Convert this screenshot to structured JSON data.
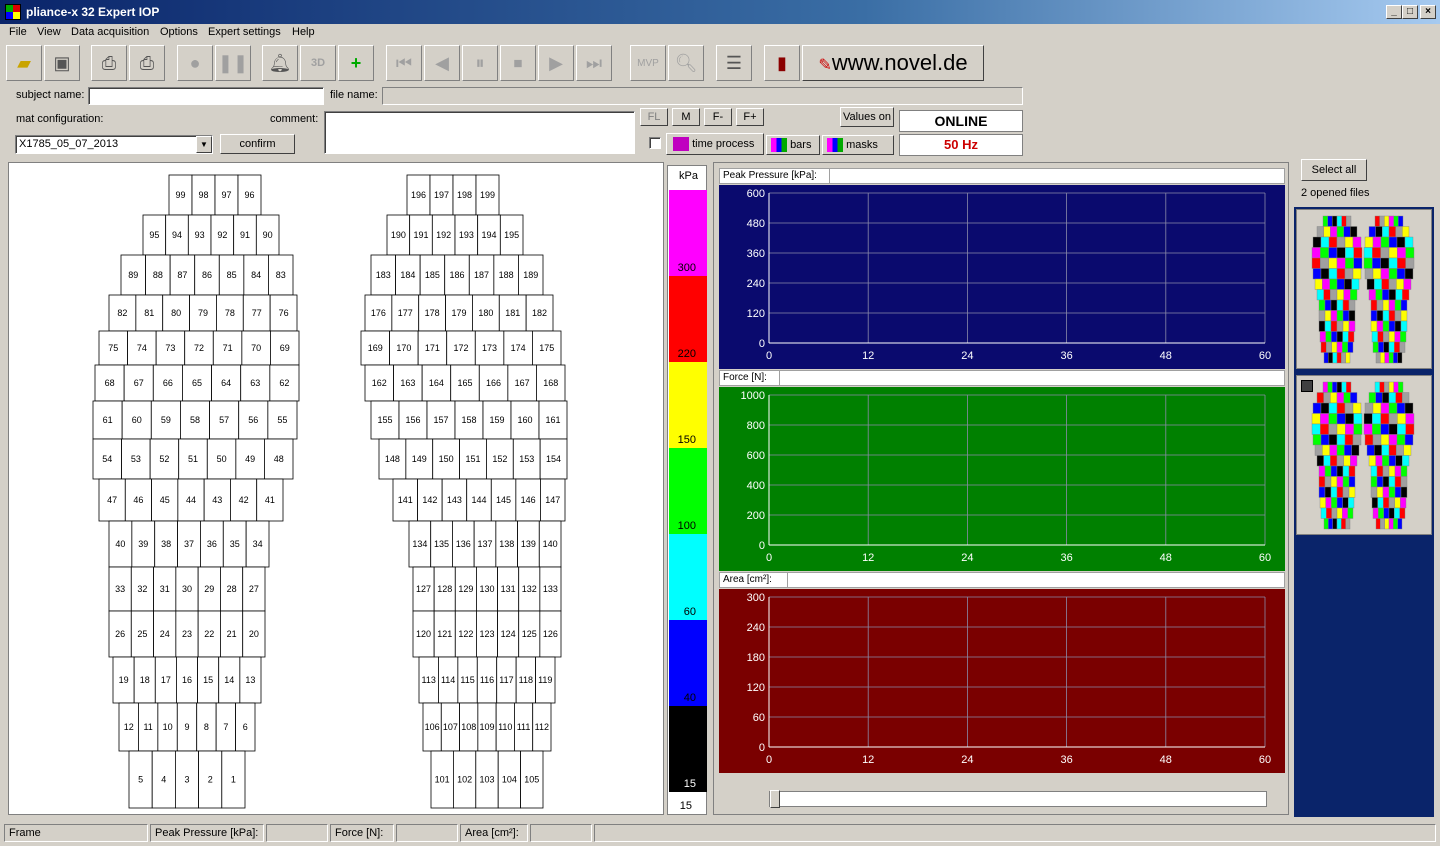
{
  "window": {
    "title": "pliance-x 32 Expert IOP",
    "btn_min": "_",
    "btn_max": "□",
    "btn_close": "×"
  },
  "menu": [
    "File",
    "View",
    "Data acquisition",
    "Options",
    "Expert settings",
    "Help"
  ],
  "toolbar": {
    "icons": [
      "open-folder",
      "save",
      "print",
      "print-preview",
      "record",
      "pause",
      "alarm-bell",
      "3d-view",
      "add-steps",
      "first-frame",
      "prev-frame",
      "pause-playback",
      "stop-playback",
      "next-frame",
      "last-frame",
      "mvp",
      "zoom",
      "notes",
      "exit-door"
    ],
    "mvp_label": "MVP",
    "threed_label": "3D",
    "brand_link": "www.novel.de"
  },
  "form": {
    "subject_label": "subject name:",
    "subject_value": "",
    "file_label": "file name:",
    "file_value": "",
    "mat_label": "mat configuration:",
    "mat_value": "X1785_05_07_2013",
    "confirm": "confirm",
    "comment_label": "comment:",
    "comment_value": "",
    "fl": "FL",
    "m": "M",
    "fminus": "F-",
    "fplus": "F+",
    "values_on": "Values on",
    "time_process": "time process",
    "bars": "bars",
    "masks": "masks",
    "status": "ONLINE",
    "frequency": "50 Hz"
  },
  "sensors": {
    "left": [
      [
        99,
        98,
        97,
        96
      ],
      [
        95,
        94,
        93,
        92,
        91,
        90
      ],
      [
        89,
        88,
        87,
        86,
        85,
        84,
        83
      ],
      [
        82,
        81,
        80,
        79,
        78,
        77,
        76
      ],
      [
        75,
        74,
        73,
        72,
        71,
        70,
        69
      ],
      [
        68,
        67,
        66,
        65,
        64,
        63,
        62
      ],
      [
        61,
        60,
        59,
        58,
        57,
        56,
        55
      ],
      [
        54,
        53,
        52,
        51,
        50,
        49,
        48
      ],
      [
        47,
        46,
        45,
        44,
        43,
        42,
        41
      ],
      [
        40,
        39,
        38,
        37,
        36,
        35,
        34
      ],
      [
        33,
        32,
        31,
        30,
        29,
        28,
        27
      ],
      [
        26,
        25,
        24,
        23,
        22,
        21,
        20
      ],
      [
        19,
        18,
        17,
        16,
        15,
        14,
        13
      ],
      [
        12,
        11,
        10,
        9,
        8,
        7,
        6
      ],
      [
        5,
        4,
        3,
        2,
        1
      ]
    ],
    "right": [
      [
        196,
        197,
        198,
        199
      ],
      [
        190,
        191,
        192,
        193,
        194,
        195
      ],
      [
        183,
        184,
        185,
        186,
        187,
        188,
        189
      ],
      [
        176,
        177,
        178,
        179,
        180,
        181,
        182
      ],
      [
        169,
        170,
        171,
        172,
        173,
        174,
        175
      ],
      [
        162,
        163,
        164,
        165,
        166,
        167,
        168
      ],
      [
        155,
        156,
        157,
        158,
        159,
        160,
        161
      ],
      [
        148,
        149,
        150,
        151,
        152,
        153,
        154
      ],
      [
        141,
        142,
        143,
        144,
        145,
        146,
        147
      ],
      [
        134,
        135,
        136,
        137,
        138,
        139,
        140
      ],
      [
        127,
        128,
        129,
        130,
        131,
        132,
        133
      ],
      [
        120,
        121,
        122,
        123,
        124,
        125,
        126
      ],
      [
        113,
        114,
        115,
        116,
        117,
        118,
        119
      ],
      [
        106,
        107,
        108,
        109,
        110,
        111,
        112
      ],
      [
        101,
        102,
        103,
        104,
        105
      ]
    ]
  },
  "scale": {
    "unit": "kPa",
    "labels": [
      "300",
      "220",
      "150",
      "100",
      "60",
      "40",
      "15"
    ],
    "bottom": "15",
    "colors": [
      "#ff00ff",
      "#ff0000",
      "#ffff00",
      "#00ff00",
      "#00ffff",
      "#0000ff",
      "#000000"
    ]
  },
  "chart_data": [
    {
      "type": "line",
      "title": "Peak Pressure  [kPa]:",
      "x": [
        0,
        12,
        24,
        36,
        48,
        60
      ],
      "yticks": [
        0,
        120,
        240,
        360,
        480,
        600
      ],
      "ylim": [
        0,
        600
      ],
      "xlim": [
        0,
        60
      ],
      "background": "#0a0a6e",
      "series": []
    },
    {
      "type": "line",
      "title": "Force [N]:",
      "x": [
        0,
        12,
        24,
        36,
        48,
        60
      ],
      "yticks": [
        0,
        200,
        400,
        600,
        800,
        1000
      ],
      "ylim": [
        0,
        1000
      ],
      "xlim": [
        0,
        60
      ],
      "background": "#008000",
      "series": []
    },
    {
      "type": "line",
      "title": "Area [cm²]:",
      "x": [
        0,
        12,
        24,
        36,
        48,
        60
      ],
      "yticks": [
        0,
        60,
        120,
        180,
        240,
        300
      ],
      "ylim": [
        0,
        300
      ],
      "xlim": [
        0,
        60
      ],
      "background": "#7a0000",
      "series": []
    }
  ],
  "files": {
    "select_all": "Select all",
    "count_label": "2 opened files"
  },
  "statusbar": {
    "frame": "Frame",
    "peak": "Peak Pressure  [kPa]:",
    "force": "Force [N]:",
    "area": "Area [cm²]:"
  }
}
